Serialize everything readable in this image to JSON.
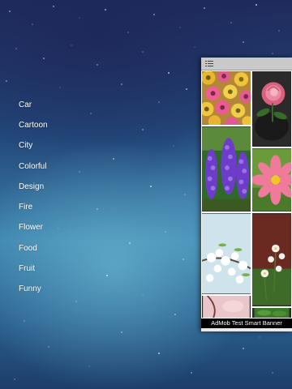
{
  "categories": {
    "items": [
      {
        "label": "Car"
      },
      {
        "label": "Cartoon"
      },
      {
        "label": "City"
      },
      {
        "label": "Colorful"
      },
      {
        "label": "Design"
      },
      {
        "label": "Fire"
      },
      {
        "label": "Flower"
      },
      {
        "label": "Food"
      },
      {
        "label": "Fruit"
      },
      {
        "label": "Funny"
      }
    ]
  },
  "gallery": {
    "menu_icon": "list-icon",
    "tiles": [
      {
        "subject": "yellow and pink gerbera flowers"
      },
      {
        "subject": "pink rose with dark background"
      },
      {
        "subject": "purple lupine flowers"
      },
      {
        "subject": "pink cosmos flower"
      },
      {
        "subject": "white blossom branch"
      },
      {
        "subject": "white flowers on dark red background"
      },
      {
        "subject": "pink petals close-up"
      },
      {
        "subject": "green leaves"
      }
    ]
  },
  "ad_banner": {
    "text": "AdMob Test Smart Banner"
  }
}
